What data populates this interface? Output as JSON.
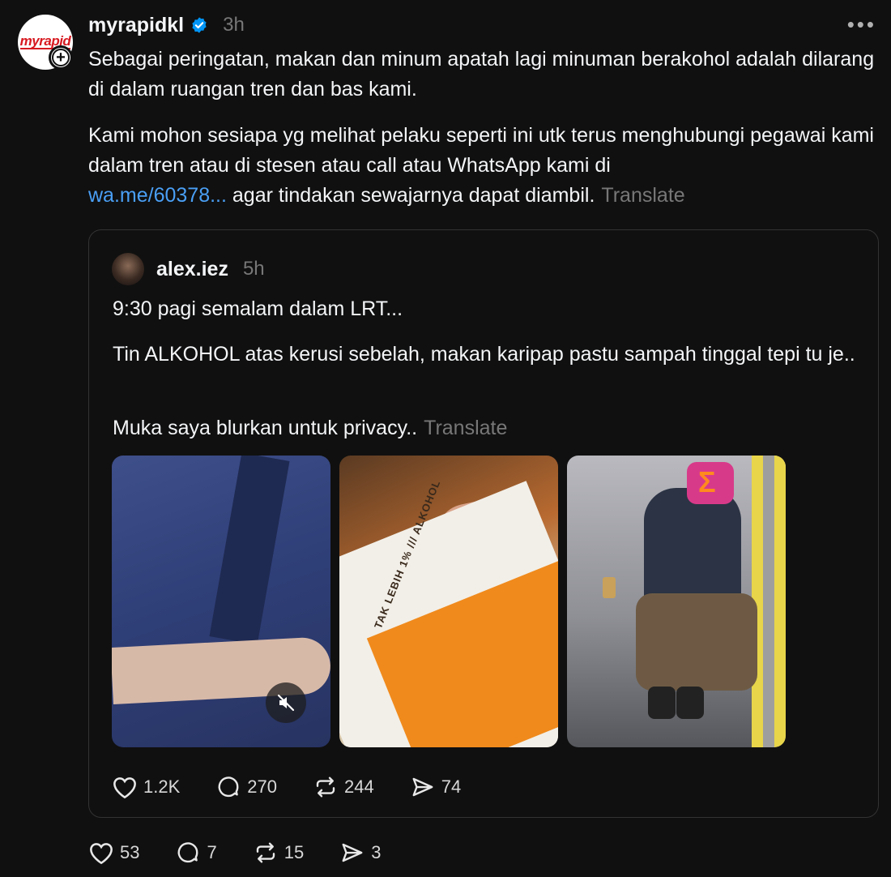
{
  "post": {
    "username": "myrapidkl",
    "time": "3h",
    "avatar_logo": "myrapid",
    "paragraph1": "Sebagai peringatan, makan dan minum apatah lagi minuman berakohol adalah dilarang di dalam ruangan tren dan bas kami.",
    "paragraph2_text": "Kami mohon sesiapa yg melihat pelaku seperti ini utk terus menghubungi pegawai kami dalam tren atau di stesen atau call atau WhatsApp kami di",
    "link": "wa.me/60378...",
    "paragraph2_tail": "agar tindakan sewajarnya dapat diambil.",
    "translate": "Translate",
    "likes": "53",
    "replies": "7",
    "reposts": "15",
    "shares": "3"
  },
  "quote": {
    "username": "alex.iez",
    "time": "5h",
    "line1": "9:30 pagi semalam dalam LRT...",
    "line2": "Tin ALKOHOL atas kerusi sebelah, makan karipap pastu sampah tinggal tepi tu je..",
    "line3": "Muka saya blurkan untuk privacy..",
    "translate": "Translate",
    "can_label": "TAK LEBIH 1% /// ALKOHOL",
    "likes": "1.2K",
    "replies": "270",
    "reposts": "244",
    "shares": "74"
  },
  "icons": {
    "more": "more-options-icon",
    "verified": "verified-badge-icon",
    "follow": "plus-icon",
    "mute": "muted-speaker-icon",
    "like": "heart-icon",
    "reply": "comment-bubble-icon",
    "repost": "repost-icon",
    "share": "send-icon"
  },
  "colors": {
    "background": "#101010",
    "text": "#f3f5f7",
    "muted": "#777777",
    "link": "#4a9ff5",
    "verified": "#0095f6",
    "brand_red": "#d71920"
  }
}
